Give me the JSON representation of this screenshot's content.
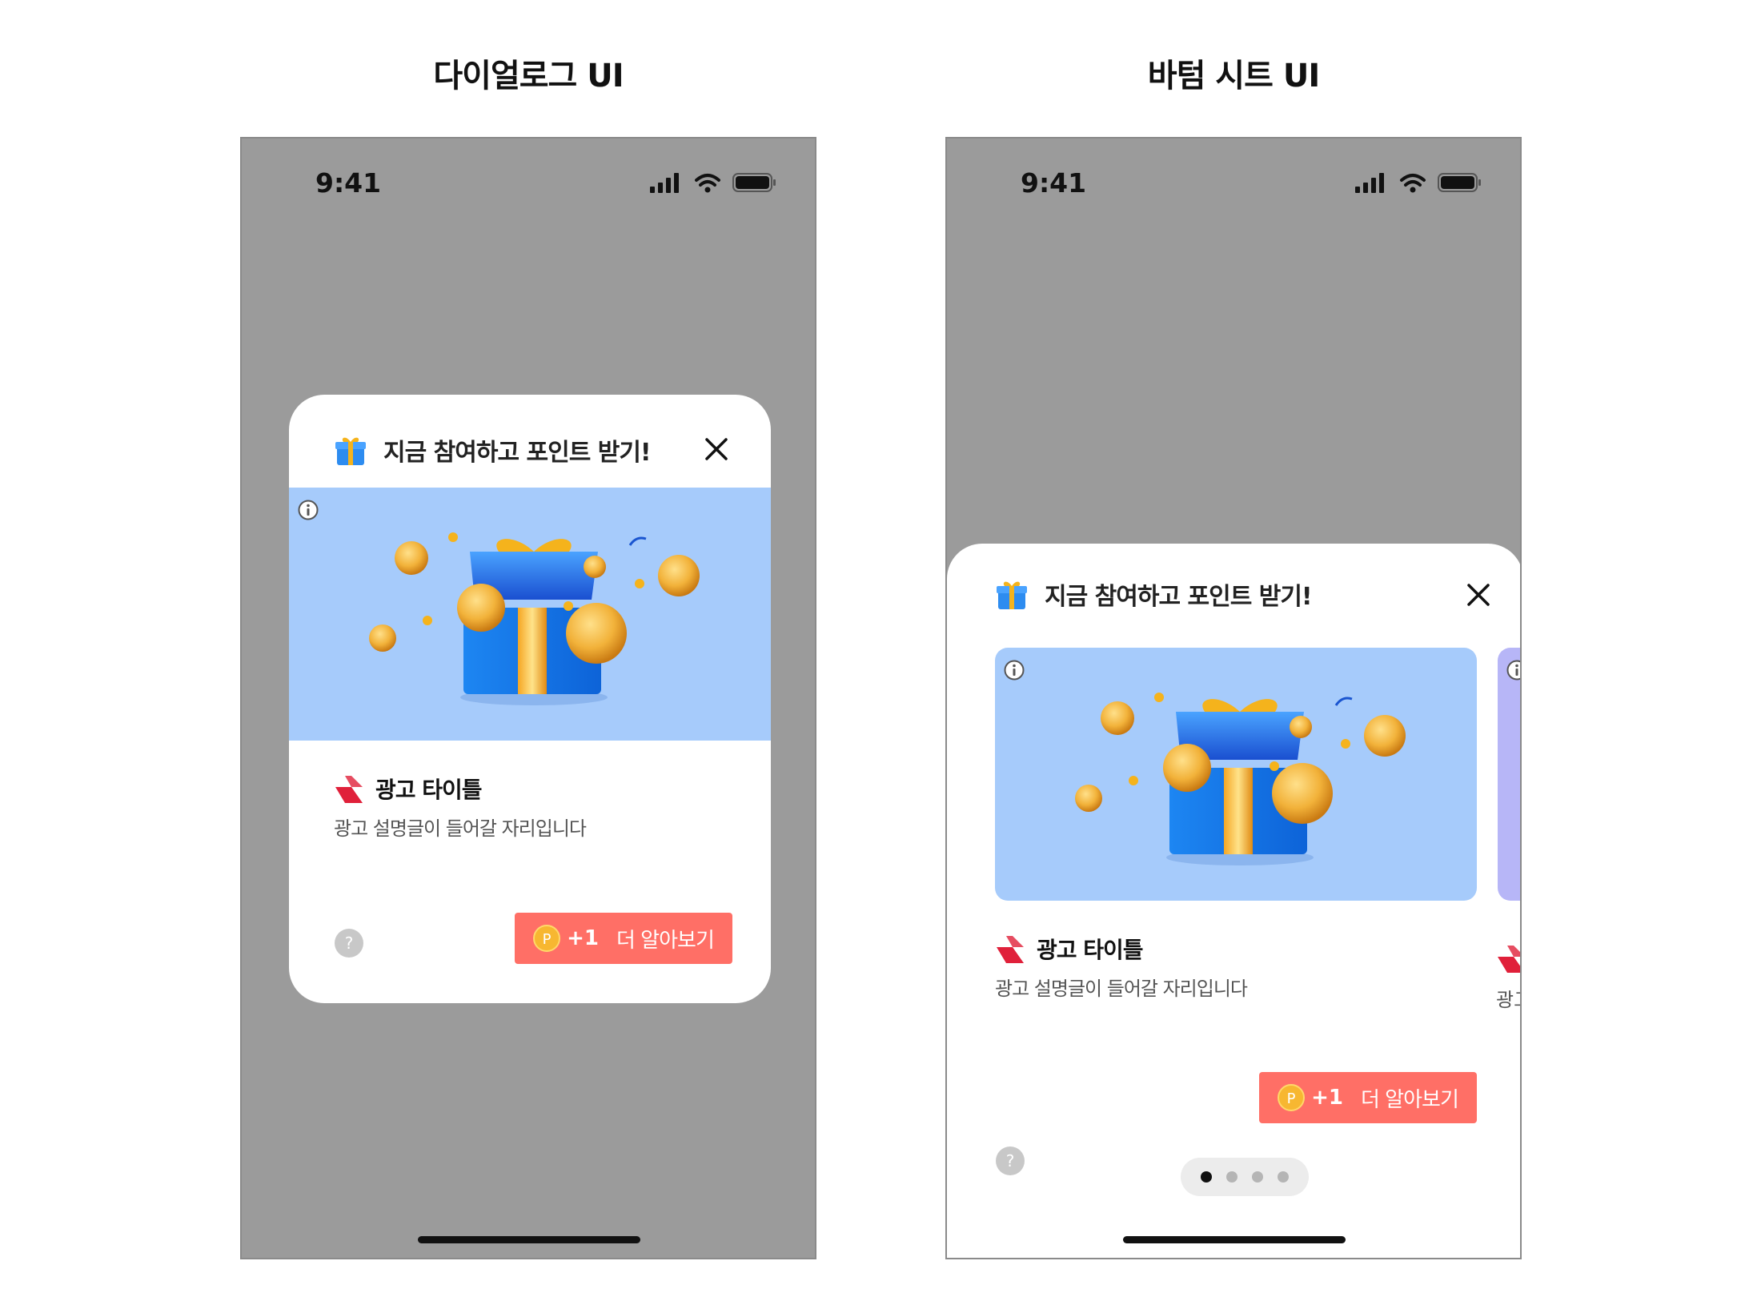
{
  "labels": {
    "dialog_ui": "다이얼로그 UI",
    "bottom_sheet_ui": "바텀 시트 UI"
  },
  "status_bar": {
    "time": "9:41"
  },
  "popup": {
    "title": "지금 참여하고 포인트 받기!",
    "ad_title": "광고 타이틀",
    "ad_description": "광고 설명글이 들어갈 자리입니다",
    "reward": "+1",
    "cta_label": "더 알아보기",
    "help_symbol": "?",
    "coin_letter": "P"
  },
  "peek_card": {
    "ad_description_fragment": "광고"
  },
  "pager": {
    "count": 4,
    "active_index": 0
  },
  "colors": {
    "dimmed_background": "#9b9b9b",
    "banner_blue": "#a6cbfb",
    "banner_purple": "#b7b6f7",
    "cta_red": "#ff6f66",
    "coin_gold": "#f7b731"
  },
  "icons": [
    "gift-icon",
    "close-icon",
    "info-icon",
    "ad-brand-logo",
    "help-icon",
    "coin-icon",
    "signal-icon",
    "wifi-icon",
    "battery-icon"
  ]
}
